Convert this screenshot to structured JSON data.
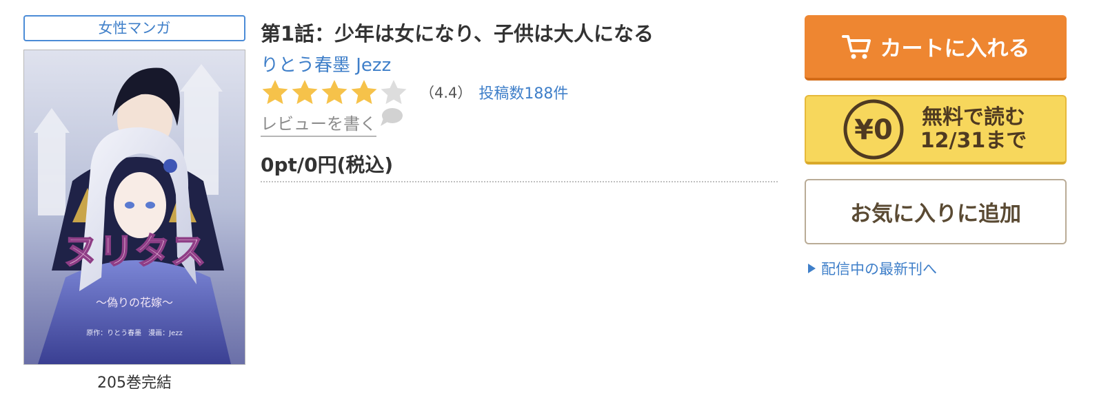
{
  "genre": "女性マンガ",
  "book": {
    "cover_title": "ヌリタス",
    "cover_subtitle": "〜偽りの花嫁〜",
    "cover_credit": "原作：りとう春墨　漫画：Jezz",
    "volume_count": "205巻完結",
    "episode_title": "第1話：少年は女になり、子供は大人になる",
    "authors": "りとう春墨 Jezz",
    "rating": 4.4,
    "rating_text": "（4.4）",
    "review_count_text": "投稿数188件",
    "write_review_label": "レビューを書く",
    "price": "0pt/0円(税込)"
  },
  "buttons": {
    "cart_label": "カートに入れる",
    "free_yen": "¥0",
    "free_line1": "無料で読む",
    "free_line2": "12/31まで",
    "favorite_label": "お気に入りに追加"
  },
  "latest_link": "配信中の最新刊へ",
  "icons": {
    "cart": "cart-icon",
    "stars": "star-icon",
    "comment": "speech-bubble-icon",
    "yen": "yen-circle-icon",
    "arrow": "triangle-right-icon"
  },
  "colors": {
    "link_blue": "#3f7fc9",
    "cart_orange": "#ee8631",
    "free_yellow": "#f7d75c",
    "star_gold": "#f6c24a",
    "star_empty": "#dddddd"
  }
}
